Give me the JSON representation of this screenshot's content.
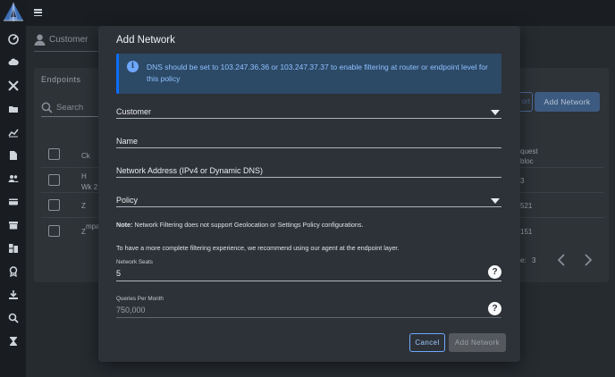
{
  "background": {
    "user_label": "Customer",
    "card_title": "Endpoints",
    "search_placeholder": "Search",
    "column_header": "Ck",
    "column_header_right_1": "quest",
    "column_header_right_2": "bloc",
    "rows": [
      {
        "c1": "H",
        "c2": "Wk 2",
        "right": "3"
      },
      {
        "c1": "Z",
        "c2": "",
        "right": "521"
      },
      {
        "c1": "Z",
        "c2": "mpa",
        "right": "151"
      }
    ],
    "partial_button": "ort",
    "add_network_button": "Add Network",
    "pager_prefix": "e:",
    "pager_value": "3"
  },
  "modal": {
    "title": "Add Network",
    "alert": "DNS should be set to 103.247.36.36 or 103.247.37.37 to enable filtering at router or endpoint level for this policy",
    "customer_label": "Customer",
    "name_label": "Name",
    "address_label": "Network Address (IPv4 or Dynamic DNS)",
    "policy_label": "Policy",
    "note_bold": "Note:",
    "note_text": " Network Filtering does not support Geolocation or Settings Policy configurations.",
    "recommend_text": "To have a more complete filtering experience, we recommend using our agent at the endpoint layer.",
    "seats_label": "Network Seats",
    "seats_value": "5",
    "queries_label": "Queries Per Month",
    "queries_value": "750,000",
    "help_glyph": "?",
    "cancel_label": "Cancel",
    "submit_label": "Add Network"
  },
  "colors": {
    "accent": "#6ea8fe",
    "alert_bg": "#2c4966",
    "modal_bg": "#2d3238"
  },
  "sidebar_icons": [
    "logo-icon",
    "dashboard-icon",
    "cloud-icon",
    "tools-icon",
    "folder-icon",
    "chart-icon",
    "document-icon",
    "users-icon",
    "card-icon",
    "archive-icon",
    "building-icon",
    "badge-icon",
    "download-icon",
    "search-icon",
    "hourglass-icon"
  ]
}
